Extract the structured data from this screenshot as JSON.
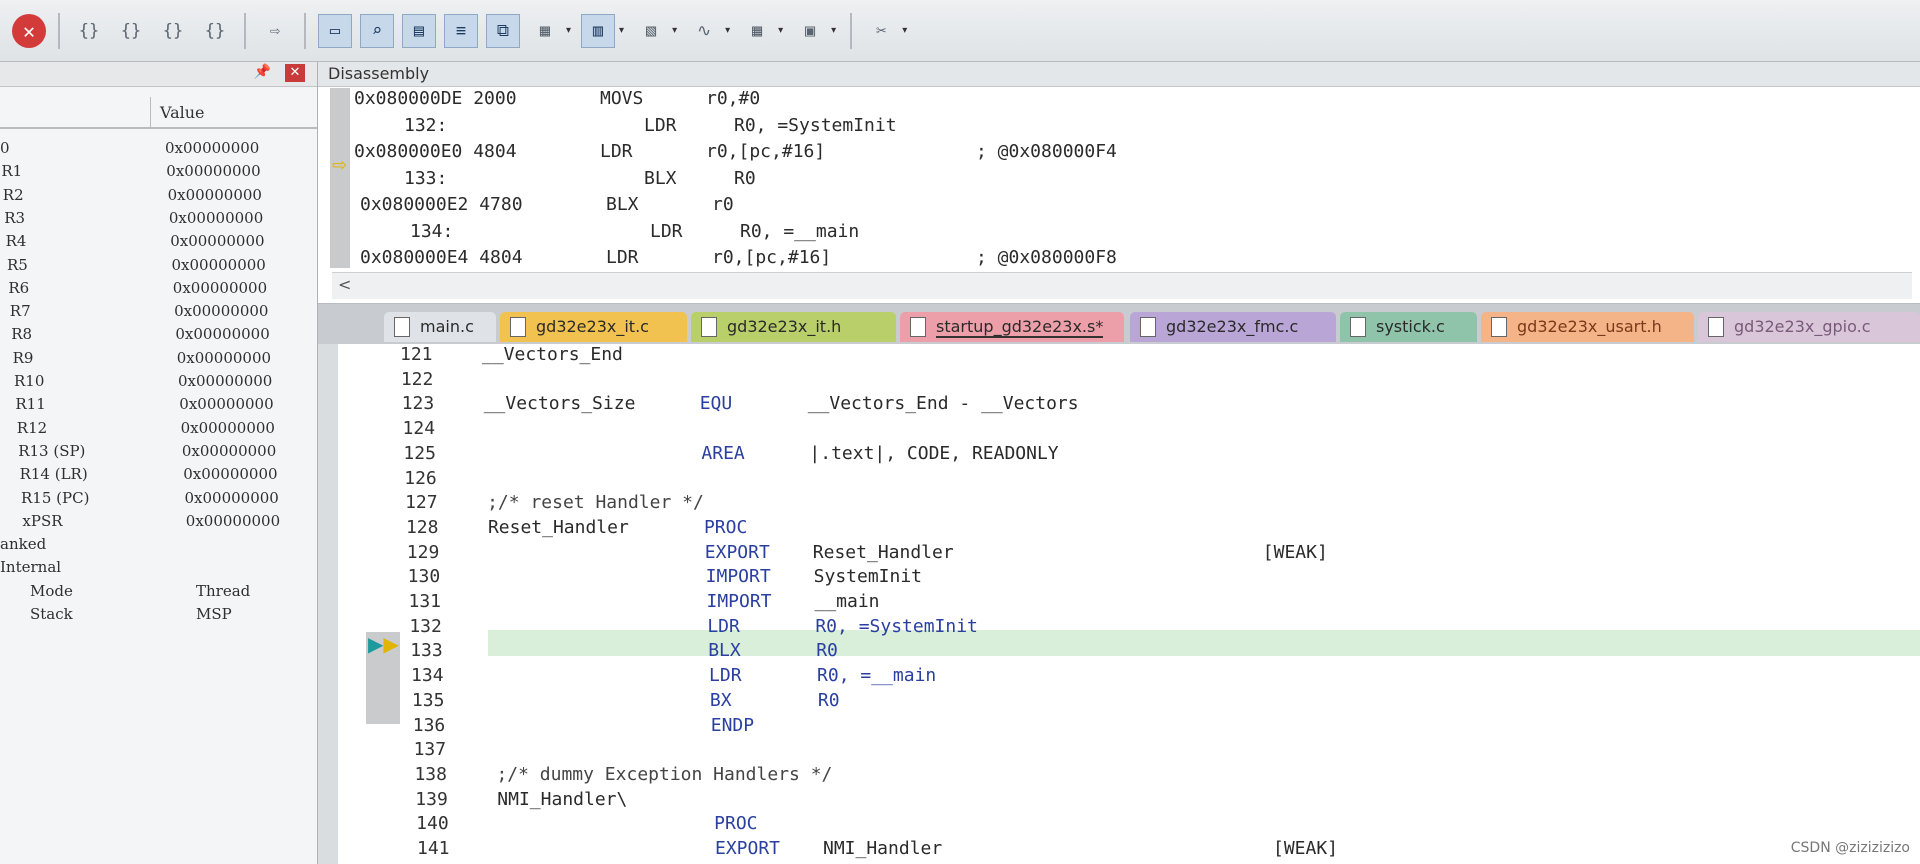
{
  "toolbar": {
    "buttons": [
      {
        "name": "stop-icon",
        "glyph": "✕"
      },
      {
        "name": "step-into-icon",
        "glyph": "{}"
      },
      {
        "name": "step-over-icon",
        "glyph": "{}"
      },
      {
        "name": "step-out-icon",
        "glyph": "{}"
      },
      {
        "name": "run-to-cursor-icon",
        "glyph": "{}"
      },
      {
        "name": "show-next-statement-icon",
        "glyph": "⇨"
      },
      {
        "name": "command-window-icon",
        "glyph": "▭"
      },
      {
        "name": "disassembly-window-icon",
        "glyph": "⌕"
      },
      {
        "name": "symbols-window-icon",
        "glyph": "▤"
      },
      {
        "name": "registers-window-icon",
        "glyph": "≡"
      },
      {
        "name": "call-stack-icon",
        "glyph": "⧉"
      },
      {
        "name": "watch-window-icon",
        "glyph": "▦"
      },
      {
        "name": "memory-window-icon",
        "glyph": "▥"
      },
      {
        "name": "serial-window-icon",
        "glyph": "▧"
      },
      {
        "name": "analysis-window-icon",
        "glyph": "∿"
      },
      {
        "name": "trace-window-icon",
        "glyph": "▦"
      },
      {
        "name": "system-viewer-icon",
        "glyph": "▣"
      },
      {
        "name": "toolbox-icon",
        "glyph": "✂"
      }
    ]
  },
  "registers": {
    "value_header": "Value",
    "rows": [
      {
        "name": "0",
        "value": "0x00000000"
      },
      {
        "name": "R1",
        "value": "0x00000000"
      },
      {
        "name": "R2",
        "value": "0x00000000"
      },
      {
        "name": "R3",
        "value": "0x00000000"
      },
      {
        "name": "R4",
        "value": "0x00000000"
      },
      {
        "name": "R5",
        "value": "0x00000000"
      },
      {
        "name": "R6",
        "value": "0x00000000"
      },
      {
        "name": "R7",
        "value": "0x00000000"
      },
      {
        "name": "R8",
        "value": "0x00000000"
      },
      {
        "name": "R9",
        "value": "0x00000000"
      },
      {
        "name": "R10",
        "value": "0x00000000"
      },
      {
        "name": "R11",
        "value": "0x00000000"
      },
      {
        "name": "R12",
        "value": "0x00000000"
      },
      {
        "name": "R13 (SP)",
        "value": "0x00000000"
      },
      {
        "name": "R14 (LR)",
        "value": "0x00000000"
      },
      {
        "name": "R15 (PC)",
        "value": "0x00000000"
      },
      {
        "name": "xPSR",
        "value": "0x00000000"
      },
      {
        "name": "anked",
        "value": ""
      },
      {
        "name": "Internal",
        "value": ""
      },
      {
        "name": "Mode",
        "value": "Thread"
      },
      {
        "name": "Stack",
        "value": "MSP"
      }
    ]
  },
  "disassembly": {
    "title": "Disassembly",
    "lines": [
      {
        "addr": "0x080000DE 2000",
        "op": "MOVS",
        "args": "r0,#0",
        "cmt": ""
      },
      {
        "addr": "132:",
        "op": "LDR",
        "args": "R0, =SystemInit",
        "cmt": ""
      },
      {
        "addr": "0x080000E0 4804",
        "op": "LDR",
        "args": "r0,[pc,#16]",
        "cmt": "; @0x080000F4"
      },
      {
        "addr": "133:",
        "op": "BLX",
        "args": "R0",
        "cmt": ""
      },
      {
        "addr": "0x080000E2 4780",
        "op": "BLX",
        "args": "r0",
        "cmt": ""
      },
      {
        "addr": "134:",
        "op": "LDR",
        "args": "R0, =__main",
        "cmt": ""
      },
      {
        "addr": "0x080000E4 4804",
        "op": "LDR",
        "args": "r0,[pc,#16]",
        "cmt": "; @0x080000F8"
      }
    ],
    "scroll_left": "<"
  },
  "tabs": [
    {
      "label": "main.c",
      "color": "#dfe3e8",
      "text": "#2a2a2a"
    },
    {
      "label": "gd32e23x_it.c",
      "color": "#f1c250",
      "text": "#2a2a2a"
    },
    {
      "label": "gd32e23x_it.h",
      "color": "#b8cf6a",
      "text": "#2a2a2a"
    },
    {
      "label": "startup_gd32e23x.s*",
      "color": "#ec9fa8",
      "text": "#2a2a2a"
    },
    {
      "label": "gd32e23x_fmc.c",
      "color": "#b9a6d6",
      "text": "#2a2a2a"
    },
    {
      "label": "systick.c",
      "color": "#8fc4aa",
      "text": "#2a2a2a"
    },
    {
      "label": "gd32e23x_usart.h",
      "color": "#f4b487",
      "text": "#7a3a1a"
    },
    {
      "label": "gd32e23x_gpio.c",
      "color": "#d9c7d9",
      "text": "#7a5a7a"
    }
  ],
  "editor": {
    "lines": [
      {
        "n": "121",
        "label": "__Vectors_End",
        "op": "",
        "args": "",
        "extra": ""
      },
      {
        "n": "122",
        "label": "",
        "op": "",
        "args": "",
        "extra": ""
      },
      {
        "n": "123",
        "label": "__Vectors_Size",
        "op": "EQU",
        "args": "__Vectors_End - __Vectors",
        "extra": ""
      },
      {
        "n": "124",
        "label": "",
        "op": "",
        "args": "",
        "extra": ""
      },
      {
        "n": "125",
        "label": "",
        "op": "AREA",
        "args": "|.text|, CODE, READONLY",
        "extra": ""
      },
      {
        "n": "126",
        "label": "",
        "op": "",
        "args": "",
        "extra": ""
      },
      {
        "n": "127",
        "label": ";/* reset Handler */",
        "op": "",
        "args": "",
        "extra": ""
      },
      {
        "n": "128",
        "label": "Reset_Handler",
        "op": "PROC",
        "args": "",
        "extra": ""
      },
      {
        "n": "129",
        "label": "",
        "op": "EXPORT",
        "args": "Reset_Handler",
        "extra": "[WEAK]"
      },
      {
        "n": "130",
        "label": "",
        "op": "IMPORT",
        "args": "SystemInit",
        "extra": ""
      },
      {
        "n": "131",
        "label": "",
        "op": "IMPORT",
        "args": "__main",
        "extra": ""
      },
      {
        "n": "132",
        "label": "",
        "op": "LDR",
        "args": "R0, =SystemInit",
        "extra": ""
      },
      {
        "n": "133",
        "label": "",
        "op": "BLX",
        "args": "R0",
        "extra": ""
      },
      {
        "n": "134",
        "label": "",
        "op": "LDR",
        "args": "R0, =__main",
        "extra": ""
      },
      {
        "n": "135",
        "label": "",
        "op": "BX",
        "args": "R0",
        "extra": ""
      },
      {
        "n": "136",
        "label": "",
        "op": "ENDP",
        "args": "",
        "extra": ""
      },
      {
        "n": "137",
        "label": "",
        "op": "",
        "args": "",
        "extra": ""
      },
      {
        "n": "138",
        "label": ";/* dummy Exception Handlers */",
        "op": "",
        "args": "",
        "extra": ""
      },
      {
        "n": "139",
        "label": "NMI_Handler\\",
        "op": "",
        "args": "",
        "extra": ""
      },
      {
        "n": "140",
        "label": "",
        "op": "PROC",
        "args": "",
        "extra": ""
      },
      {
        "n": "141",
        "label": "",
        "op": "EXPORT",
        "args": "NMI_Handler",
        "extra": "[WEAK]"
      }
    ]
  },
  "watermark": "CSDN @zizizizizo"
}
